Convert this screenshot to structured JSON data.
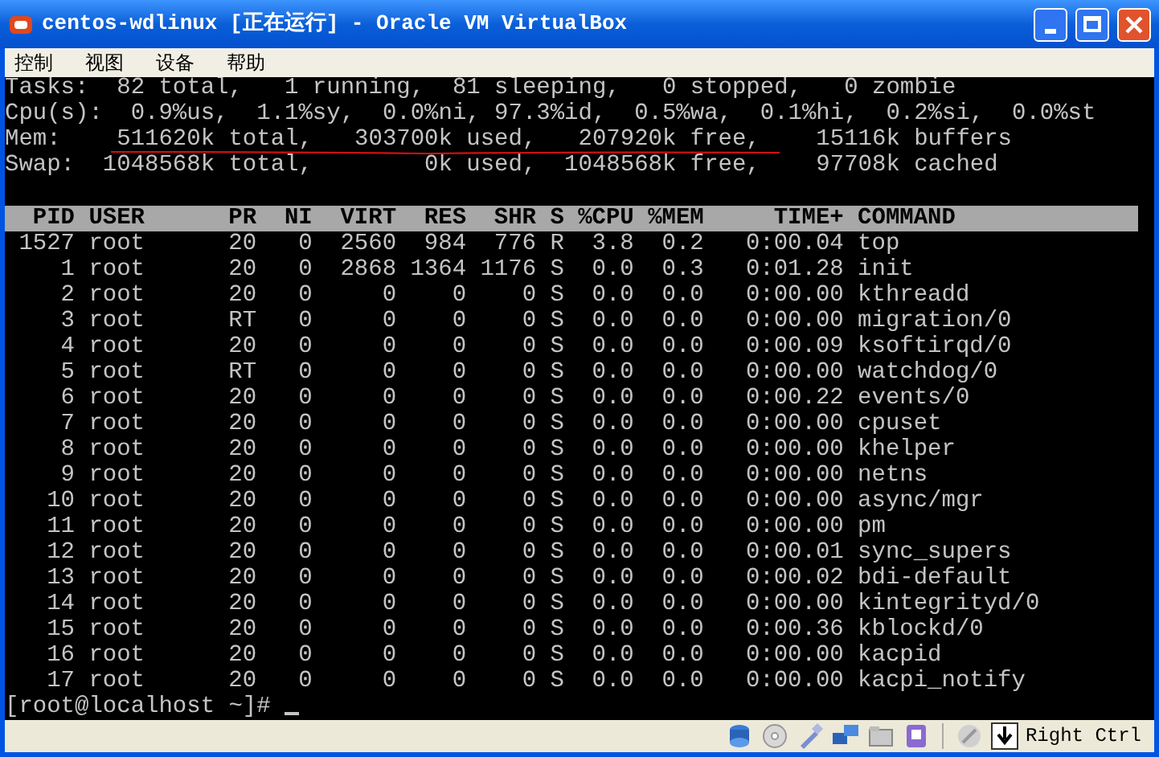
{
  "window": {
    "title": "centos-wdlinux [正在运行] - Oracle VM VirtualBox"
  },
  "menu": [
    "控制",
    "视图",
    "设备",
    "帮助"
  ],
  "summary": [
    "Tasks:  82 total,   1 running,  81 sleeping,   0 stopped,   0 zombie",
    "Cpu(s):  0.9%us,  1.1%sy,  0.0%ni, 97.3%id,  0.5%wa,  0.1%hi,  0.2%si,  0.0%st",
    "Mem:    511620k total,   303700k used,   207920k free,    15116k buffers",
    "Swap:  1048568k total,        0k used,  1048568k free,    97708k cached"
  ],
  "table": {
    "columns": [
      "PID",
      "USER",
      "PR",
      "NI",
      "VIRT",
      "RES",
      "SHR",
      "S",
      "%CPU",
      "%MEM",
      "TIME+",
      "COMMAND"
    ],
    "rows": [
      {
        "cells": [
          "1527",
          "root",
          "20",
          "0",
          "2560",
          "984",
          "776",
          "R",
          "3.8",
          "0.2",
          "0:00.04",
          "top"
        ]
      },
      {
        "cells": [
          "1",
          "root",
          "20",
          "0",
          "2868",
          "1364",
          "1176",
          "S",
          "0.0",
          "0.3",
          "0:01.28",
          "init"
        ]
      },
      {
        "cells": [
          "2",
          "root",
          "20",
          "0",
          "0",
          "0",
          "0",
          "S",
          "0.0",
          "0.0",
          "0:00.00",
          "kthreadd"
        ]
      },
      {
        "cells": [
          "3",
          "root",
          "RT",
          "0",
          "0",
          "0",
          "0",
          "S",
          "0.0",
          "0.0",
          "0:00.00",
          "migration/0"
        ]
      },
      {
        "cells": [
          "4",
          "root",
          "20",
          "0",
          "0",
          "0",
          "0",
          "S",
          "0.0",
          "0.0",
          "0:00.09",
          "ksoftirqd/0"
        ]
      },
      {
        "cells": [
          "5",
          "root",
          "RT",
          "0",
          "0",
          "0",
          "0",
          "S",
          "0.0",
          "0.0",
          "0:00.00",
          "watchdog/0"
        ]
      },
      {
        "cells": [
          "6",
          "root",
          "20",
          "0",
          "0",
          "0",
          "0",
          "S",
          "0.0",
          "0.0",
          "0:00.22",
          "events/0"
        ]
      },
      {
        "cells": [
          "7",
          "root",
          "20",
          "0",
          "0",
          "0",
          "0",
          "S",
          "0.0",
          "0.0",
          "0:00.00",
          "cpuset"
        ]
      },
      {
        "cells": [
          "8",
          "root",
          "20",
          "0",
          "0",
          "0",
          "0",
          "S",
          "0.0",
          "0.0",
          "0:00.00",
          "khelper"
        ]
      },
      {
        "cells": [
          "9",
          "root",
          "20",
          "0",
          "0",
          "0",
          "0",
          "S",
          "0.0",
          "0.0",
          "0:00.00",
          "netns"
        ]
      },
      {
        "cells": [
          "10",
          "root",
          "20",
          "0",
          "0",
          "0",
          "0",
          "S",
          "0.0",
          "0.0",
          "0:00.00",
          "async/mgr"
        ]
      },
      {
        "cells": [
          "11",
          "root",
          "20",
          "0",
          "0",
          "0",
          "0",
          "S",
          "0.0",
          "0.0",
          "0:00.00",
          "pm"
        ]
      },
      {
        "cells": [
          "12",
          "root",
          "20",
          "0",
          "0",
          "0",
          "0",
          "S",
          "0.0",
          "0.0",
          "0:00.01",
          "sync_supers"
        ]
      },
      {
        "cells": [
          "13",
          "root",
          "20",
          "0",
          "0",
          "0",
          "0",
          "S",
          "0.0",
          "0.0",
          "0:00.02",
          "bdi-default"
        ]
      },
      {
        "cells": [
          "14",
          "root",
          "20",
          "0",
          "0",
          "0",
          "0",
          "S",
          "0.0",
          "0.0",
          "0:00.00",
          "kintegrityd/0"
        ]
      },
      {
        "cells": [
          "15",
          "root",
          "20",
          "0",
          "0",
          "0",
          "0",
          "S",
          "0.0",
          "0.0",
          "0:00.36",
          "kblockd/0"
        ]
      },
      {
        "cells": [
          "16",
          "root",
          "20",
          "0",
          "0",
          "0",
          "0",
          "S",
          "0.0",
          "0.0",
          "0:00.00",
          "kacpid"
        ]
      },
      {
        "cells": [
          "17",
          "root",
          "20",
          "0",
          "0",
          "0",
          "0",
          "S",
          "0.0",
          "0.0",
          "0:00.00",
          "kacpi_notify"
        ]
      }
    ]
  },
  "prompt": "[root@localhost ~]#",
  "status_bar": {
    "host_key": "Right Ctrl"
  }
}
